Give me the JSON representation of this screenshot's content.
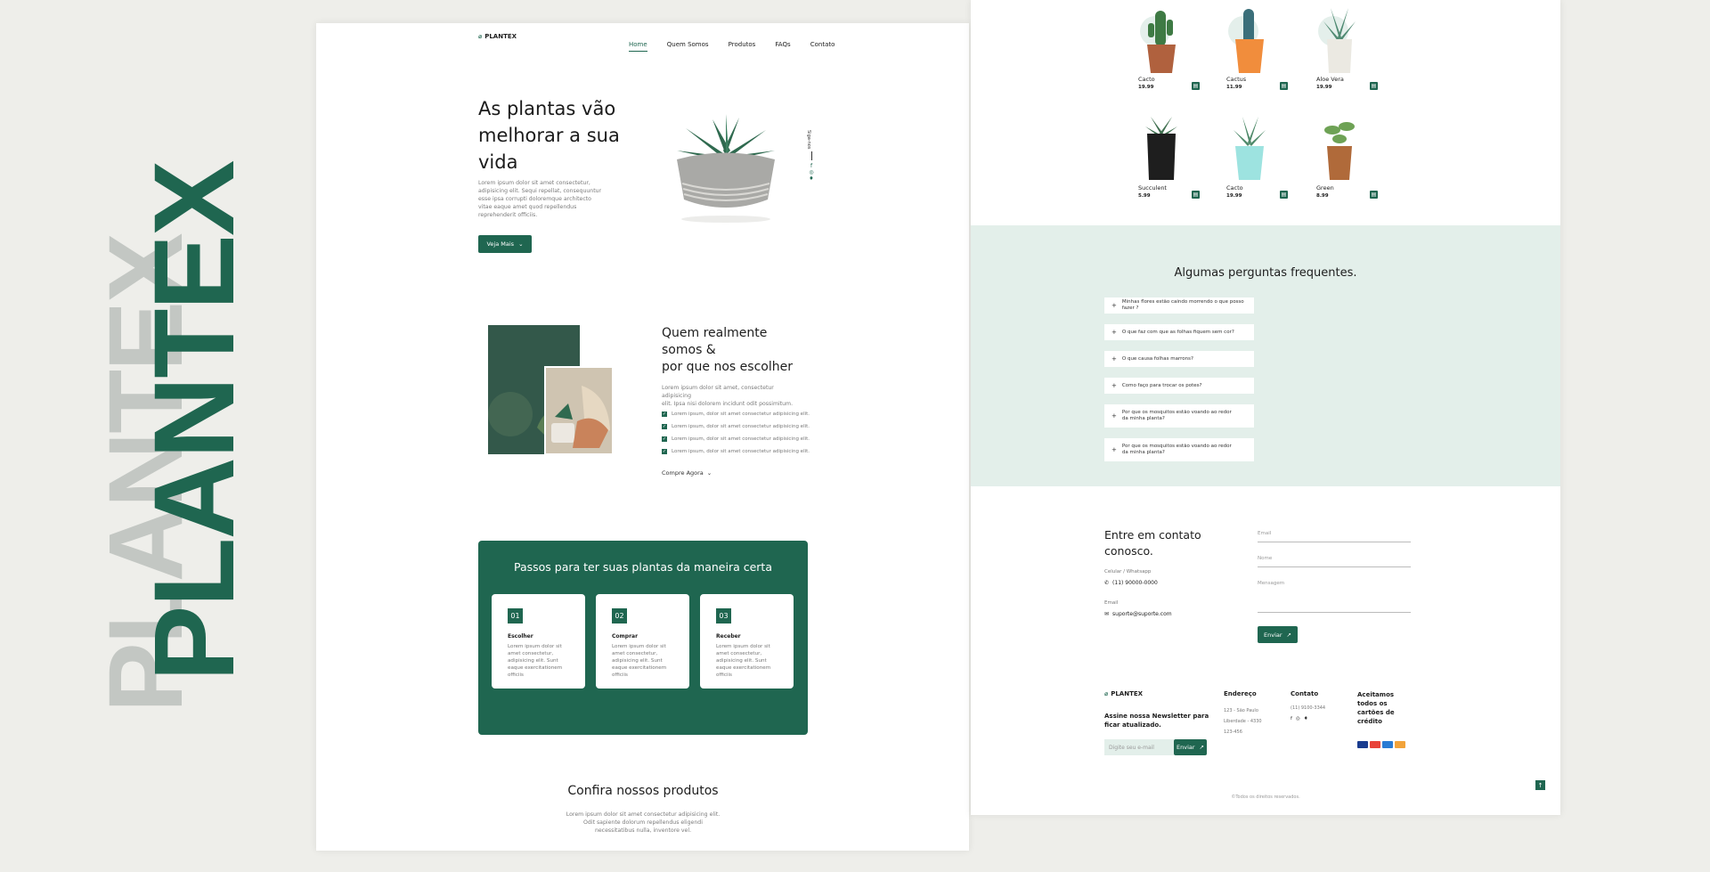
{
  "brand": {
    "word_back": "PLANTEX",
    "word_front": "PLANTEX",
    "logo": "PLANTEX"
  },
  "nav": {
    "items": [
      "Home",
      "Quem Somos",
      "Produtos",
      "FAQs",
      "Contato"
    ]
  },
  "hero": {
    "title": [
      "As plantas vão",
      "melhorar a sua",
      "vida"
    ],
    "text": [
      "Lorem ipsum dolor sit amet consectetur,",
      "adipisicing elit. Sequi repellat, consequuntur",
      "esse ipsa corrupti doloremque architecto",
      "vitae eaque amet quod repellendus",
      "reprehenderit officiis."
    ],
    "button": "Veja Mais",
    "follow": "Siga-nos"
  },
  "about": {
    "title": [
      "Quem realmente",
      "somos &",
      "por que nos escolher"
    ],
    "text": [
      "Lorem ipsum dolor sit amet, consectetur adipisicing",
      "elit. Ipsa nisi dolorem incidunt odit possimitum."
    ],
    "checks": [
      "Lorem ipsum, dolor sit amet consectetur adipisicing elit.",
      "Lorem ipsum, dolor sit amet consectetur adipisicing elit.",
      "Lorem ipsum, dolor sit amet consectetur adipisicing elit.",
      "Lorem ipsum, dolor sit amet consectetur adipisicing elit."
    ],
    "link": "Compre Agora"
  },
  "steps": {
    "title": "Passos para ter suas plantas da maneira certa",
    "items": [
      {
        "num": "01",
        "name": "Escolher",
        "text": "Lorem ipsum dolor sit amet consectetur, adipisicing elit. Sunt eaque exercitationem officiis"
      },
      {
        "num": "02",
        "name": "Comprar",
        "text": "Lorem ipsum dolor sit amet consectetur, adipisicing elit. Sunt eaque exercitationem officiis"
      },
      {
        "num": "03",
        "name": "Receber",
        "text": "Lorem ipsum dolor sit amet consectetur, adipisicing elit. Sunt eaque exercitationem officiis"
      }
    ]
  },
  "products_intro": {
    "title": "Confira nossos produtos",
    "text": [
      "Lorem ipsum dolor sit amet consectetur adipisicing elit.",
      "Odit sapiente dolorum repellendus eligendi",
      "necessitatibus nulla, inventore vel."
    ]
  },
  "products": [
    {
      "name": "Cacto",
      "price": "19.99"
    },
    {
      "name": "Cactus",
      "price": "11.99"
    },
    {
      "name": "Aloe Vera",
      "price": "19.99"
    },
    {
      "name": "Succulent",
      "price": "5.99"
    },
    {
      "name": "Cacto",
      "price": "19.99"
    },
    {
      "name": "Green",
      "price": "8.99"
    }
  ],
  "faq": {
    "title": "Algumas perguntas frequentes.",
    "items": [
      "Minhas flores estão caindo morrendo o que posso fazer ?",
      "O que faz com que as folhas fiquem sem cor?",
      "O que causa folhas marrons?",
      "Como faço para trocar os potes?",
      "Por que os mosquitos estão voando ao redor da minha planta?",
      "Por que os mosquitos estão voando ao redor da minha planta?"
    ]
  },
  "contact": {
    "title": [
      "Entre em contato",
      "conosco."
    ],
    "phone_label": "Celular / Whatsapp",
    "phone": "(11) 90000-0000",
    "email_label": "Email",
    "email": "suporte@suporte.com",
    "fields": [
      "Email",
      "Nome",
      "Mensagem"
    ],
    "send": "Enviar"
  },
  "footer": {
    "logo": "PLANTEX",
    "newsletter": [
      "Assine nossa Newsletter para",
      "ficar atualizado."
    ],
    "placeholder": "Digite seu e-mail",
    "send": "Enviar",
    "address_title": "Endereço",
    "address": [
      "123 - São Paulo",
      "Liberdade - 4330",
      "123-456"
    ],
    "contact_title": "Contato",
    "contact_phone": "(11) 9100-3344",
    "cards_title": [
      "Aceitamos",
      "todos os",
      "cartões de",
      "crédito"
    ],
    "copyright": "©Todos os direitos reservados."
  },
  "colors": {
    "accent": "#1f6650",
    "faq_bg": "#e3efea",
    "page_bg": "#eeeeea"
  }
}
